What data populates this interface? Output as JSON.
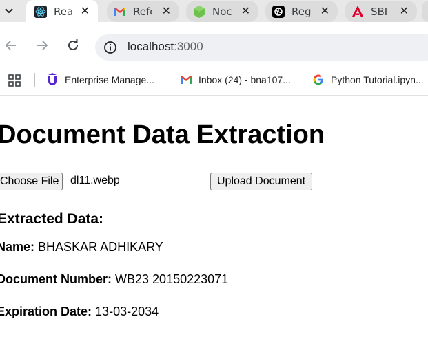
{
  "browser": {
    "tabs": [
      {
        "label": "Reac",
        "icon": "react-icon",
        "active": true
      },
      {
        "label": "Refe",
        "icon": "gmail-icon",
        "active": false
      },
      {
        "label": "Noc",
        "icon": "node-icon",
        "active": false
      },
      {
        "label": "Reg",
        "icon": "openai-icon",
        "active": false
      },
      {
        "label": "SBI",
        "icon": "angular-icon",
        "active": false
      }
    ],
    "tab_close_glyph": "✕",
    "url_host": "localhost",
    "url_port": ":3000",
    "bookmarks": [
      {
        "label": "Enterprise Manage...",
        "icon": "udemy-icon"
      },
      {
        "label": "Inbox (24) - bna107...",
        "icon": "gmail-icon"
      },
      {
        "label": "Python Tutorial.ipyn...",
        "icon": "google-icon"
      }
    ]
  },
  "page": {
    "title": "Document Data Extraction",
    "choose_file_label": "Choose File",
    "file_name": "dl11.webp",
    "upload_label": "Upload Document",
    "extracted_heading": "Extracted Data:",
    "fields": [
      {
        "label": "Name:",
        "value": "BHASKAR ADHIKARY"
      },
      {
        "label": "Document Number:",
        "value": "WB23 20150223071"
      },
      {
        "label": "Expiration Date:",
        "value": "13-03-2034"
      }
    ]
  },
  "colors": {
    "tabstrip": "#e8e8e8",
    "inactive_tab": "#dcdcdc",
    "omnibox": "#eef0f3",
    "react": "#61dafb",
    "node": "#6cc24a",
    "angular": "#dd0031",
    "gmail_red": "#ea4335",
    "udemy": "#5624d0"
  }
}
